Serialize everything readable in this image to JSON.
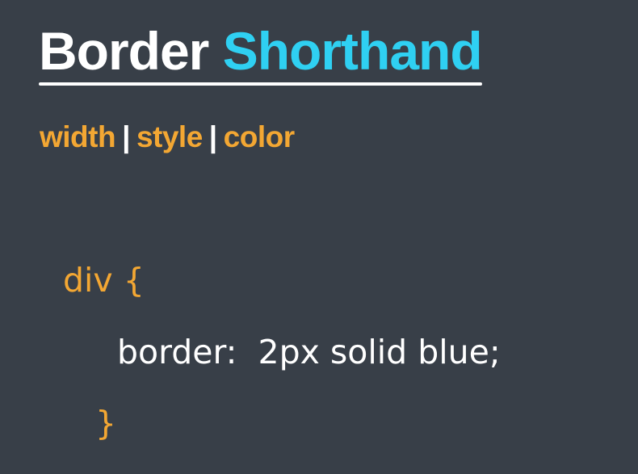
{
  "title": {
    "word1": "Border",
    "word2": "Shorthand"
  },
  "subtitle": {
    "parts": [
      "width",
      "style",
      "color"
    ],
    "separator": "|"
  },
  "code": {
    "open": "div {",
    "declaration": "border:  2px solid blue;",
    "close": "}"
  },
  "colors": {
    "background": "#383f48",
    "title_accent": "#2fd0f2",
    "orange": "#f3a733",
    "text": "#ffffff"
  }
}
